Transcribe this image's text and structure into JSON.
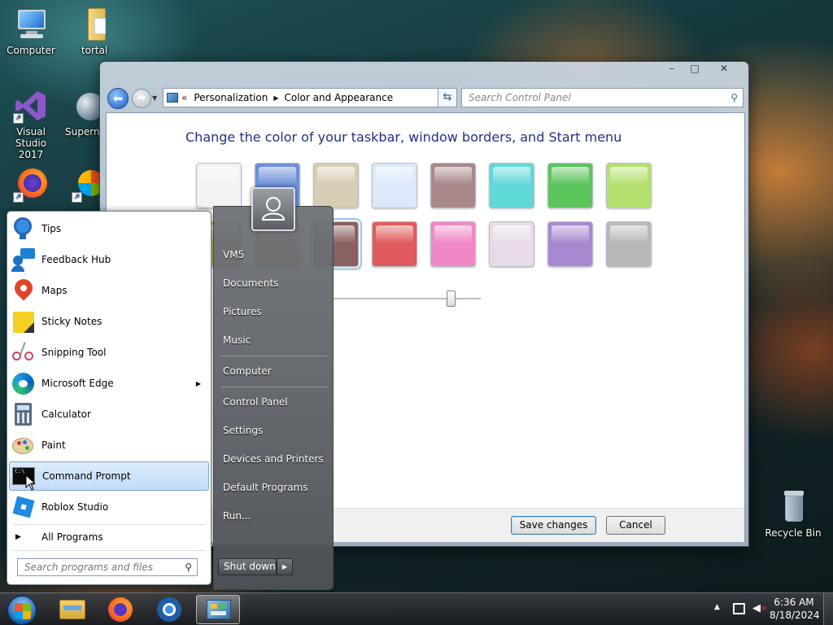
{
  "desktop": {
    "icons": [
      {
        "label": "Computer"
      },
      {
        "label": "tortal"
      },
      {
        "label": "Visual Studio 2017"
      },
      {
        "label": "Supern"
      },
      {
        "label": ""
      },
      {
        "label": ""
      },
      {
        "label": "Recycle Bin"
      }
    ]
  },
  "window": {
    "breadcrumb": [
      "Personalization",
      "Color and Appearance"
    ],
    "breadcrumb_prefix": "«",
    "search_placeholder": "Search Control Panel",
    "heading": "Change the color of your taskbar, window borders, and Start menu",
    "swatch_colors_row1": [
      "#f2f2f2",
      "#6f90d8",
      "#d8ccb4",
      "#dce9fb",
      "#a88888",
      "#60d8d8",
      "#5cc45c",
      "#b4e070"
    ],
    "swatch_colors_row2": [
      "#c4b060",
      "#e0a050",
      "#8a6060",
      "#e05c5c",
      "#f088c8",
      "#e8dbe8",
      "#a888d0",
      "#b8b8b8"
    ],
    "save_label": "Save changes",
    "cancel_label": "Cancel"
  },
  "start_menu": {
    "programs": [
      {
        "label": "Tips",
        "icon": "tips-icon"
      },
      {
        "label": "Feedback Hub",
        "icon": "feedback-hub-icon"
      },
      {
        "label": "Maps",
        "icon": "maps-icon"
      },
      {
        "label": "Sticky Notes",
        "icon": "sticky-notes-icon"
      },
      {
        "label": "Snipping Tool",
        "icon": "snipping-tool-icon"
      },
      {
        "label": "Microsoft Edge",
        "icon": "edge-icon"
      },
      {
        "label": "Calculator",
        "icon": "calculator-icon"
      },
      {
        "label": "Paint",
        "icon": "paint-icon"
      },
      {
        "label": "Command Prompt",
        "icon": "command-prompt-icon"
      },
      {
        "label": "Roblox Studio",
        "icon": "roblox-studio-icon"
      }
    ],
    "all_programs": "All Programs",
    "search_placeholder": "Search programs and files",
    "right_items": [
      "VM5",
      "Documents",
      "Pictures",
      "Music",
      "Computer",
      "Control Panel",
      "Settings",
      "Devices and Printers",
      "Default Programs",
      "Run..."
    ],
    "shutdown_label": "Shut down"
  },
  "taskbar": {
    "time": "6:36 AM",
    "date": "8/18/2024"
  }
}
